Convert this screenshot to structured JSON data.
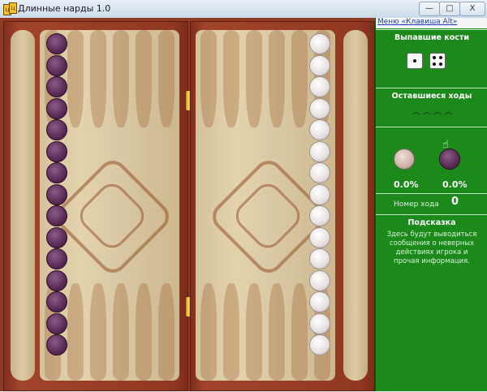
{
  "window": {
    "title": "Длинные нарды 1.0",
    "icon": "app-logo-icon",
    "buttons": {
      "minimize": "—",
      "maximize": "□",
      "close": "X"
    }
  },
  "panel": {
    "menu_label": "Меню «Клавиша Alt»",
    "dice_title": "Выпавшие кости",
    "dice_values": [
      1,
      4
    ],
    "remaining_title": "Оставшиеся ходы",
    "ornament": "෴ ෴ ෴ ෴",
    "white_percent": "0.0%",
    "black_percent": "0.0%",
    "move_label": "Номер хода",
    "move_number": "0",
    "hint_title": "Подсказка",
    "hint_text": "Здесь будут выводиться сообщения о неверных действиях игрока и прочая информация."
  },
  "board": {
    "dark_checkers": 15,
    "light_checkers": 15,
    "colors": {
      "dark": "#5a2b56",
      "light": "#e7e0e0",
      "panel": "#1b8a1b",
      "frame": "#8e3a24"
    }
  }
}
